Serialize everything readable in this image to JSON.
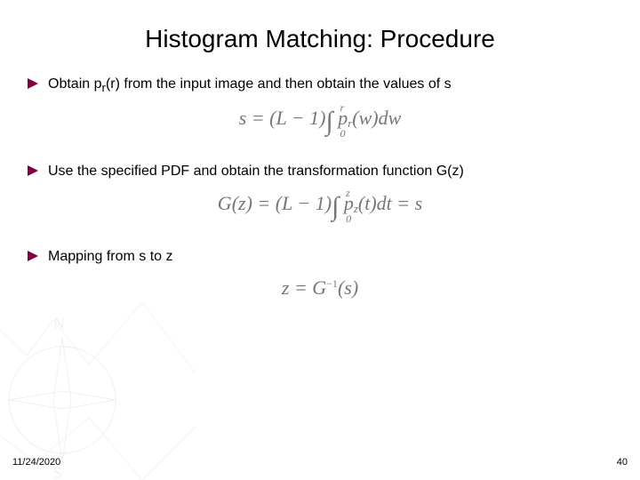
{
  "title": "Histogram Matching: Procedure",
  "items": [
    {
      "text_pre": "Obtain p",
      "text_sub": "r",
      "text_post": "(r) from the input image and then obtain the values of s",
      "equation_html": "<span>s</span> = (<span>L</span> − 1)<span class=\"int\"><span class=\"sym\">∫</span><span class=\"ub\">r</span><span class=\"lb\">0</span></span>&nbsp;<span>p</span><sub>r</sub>(<span>w</span>)<span>dw</span>"
    },
    {
      "text": "Use the specified PDF and obtain the transformation function G(z)",
      "equation_html": "<span>G</span>(<span>z</span>) = (<span>L</span> − 1)<span class=\"int\"><span class=\"sym\">∫</span><span class=\"ub\">z</span><span class=\"lb\">0</span></span>&nbsp;<span>p</span><sub>z</sub>(<span>t</span>)<span>dt</span> = <span>s</span>"
    },
    {
      "text": "Mapping from s to z",
      "equation_html": "<span>z</span> = <span>G</span><sup class=\"neg\">−1</sup>(<span>s</span>)"
    }
  ],
  "footer": {
    "date": "11/24/2020",
    "page": "40"
  },
  "colors": {
    "bullet": "#800040"
  }
}
